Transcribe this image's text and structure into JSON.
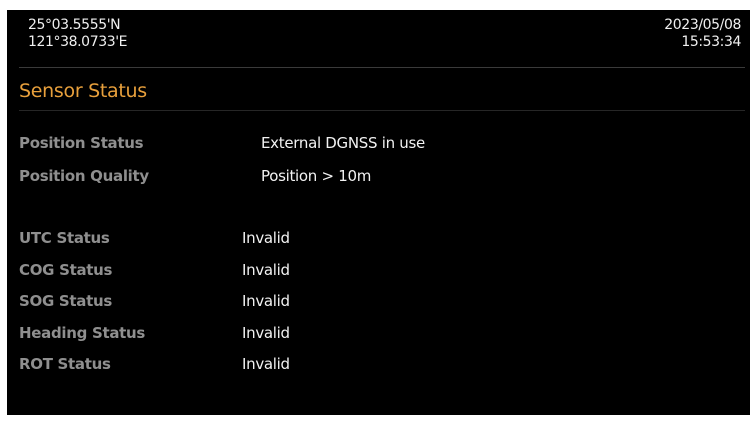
{
  "header": {
    "latitude": "25°03.5555'N",
    "longitude": "121°38.0733'E",
    "date": "2023/05/08",
    "time": "15:53:34"
  },
  "page_title": "Sensor Status",
  "position": {
    "status_label": "Position Status",
    "status_value": "External DGNSS in use",
    "quality_label": "Position Quality",
    "quality_value": "Position > 10m"
  },
  "sensors": [
    {
      "label": "UTC Status",
      "value": "Invalid"
    },
    {
      "label": "COG Status",
      "value": "Invalid"
    },
    {
      "label": "SOG Status",
      "value": "Invalid"
    },
    {
      "label": "Heading Status",
      "value": "Invalid"
    },
    {
      "label": "ROT Status",
      "value": "Invalid"
    }
  ],
  "colors": {
    "background": "#000000",
    "title": "#e8a03c",
    "label": "#8f8f8f",
    "value": "#f2f2f2"
  }
}
